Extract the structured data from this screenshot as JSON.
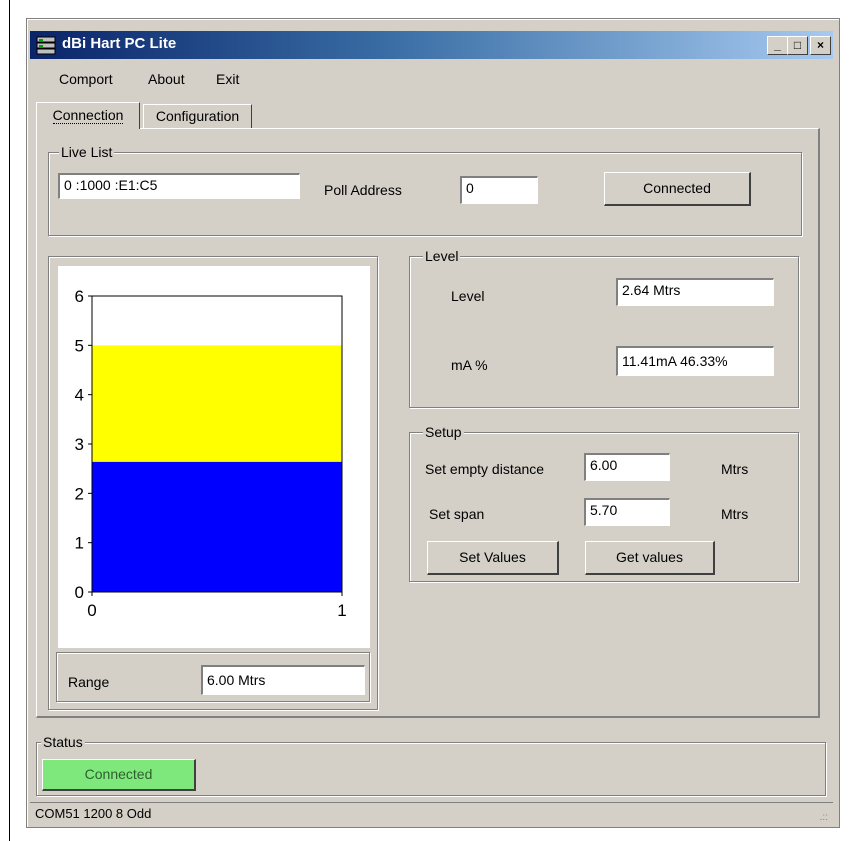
{
  "window": {
    "title": "dBi Hart PC Lite",
    "controls": {
      "minimize": "_",
      "maximize": "□",
      "close": "×"
    }
  },
  "menu": [
    "Comport",
    "About",
    "Exit"
  ],
  "tabs": [
    {
      "label": "Connection",
      "active": true
    },
    {
      "label": "Configuration",
      "active": false
    }
  ],
  "live_list": {
    "title": "Live List",
    "value": "0 :1000   :E1:C5",
    "poll_address_label": "Poll Address",
    "poll_address_value": "0",
    "connect_button": "Connected"
  },
  "chart_data": {
    "type": "bar",
    "y_ticks": [
      "0",
      "1",
      "2",
      "3",
      "4",
      "5",
      "6"
    ],
    "x_ticks": [
      "0",
      "1"
    ],
    "ylim": [
      0,
      6
    ],
    "xlim": [
      0,
      1
    ],
    "grid": false,
    "series": [
      {
        "values": [
          2.64
        ],
        "color": "#0000ff"
      },
      {
        "values": [
          2.36
        ],
        "color": "#ffff00"
      }
    ]
  },
  "range": {
    "label": "Range",
    "value": "6.00 Mtrs"
  },
  "level_group": {
    "title": "Level",
    "level_label": "Level",
    "level_value": "2.64  Mtrs",
    "ma_label": "mA %",
    "ma_value": "11.41mA 46.33%"
  },
  "setup_group": {
    "title": "Setup",
    "empty_label": "Set empty distance",
    "empty_value": "6.00",
    "empty_unit": "Mtrs",
    "span_label": "Set span",
    "span_value": "5.70",
    "span_unit": "Mtrs",
    "set_button": "Set Values",
    "get_button": "Get values"
  },
  "status": {
    "title": "Status",
    "button": "Connected",
    "bar_text": "COM51 1200 8 Odd",
    "grip": ".::"
  },
  "colors": {
    "titlebar_start": "#0a246a",
    "titlebar_end": "#a6caf0",
    "face": "#d4d0c8",
    "status_green": "#7ee87c"
  }
}
